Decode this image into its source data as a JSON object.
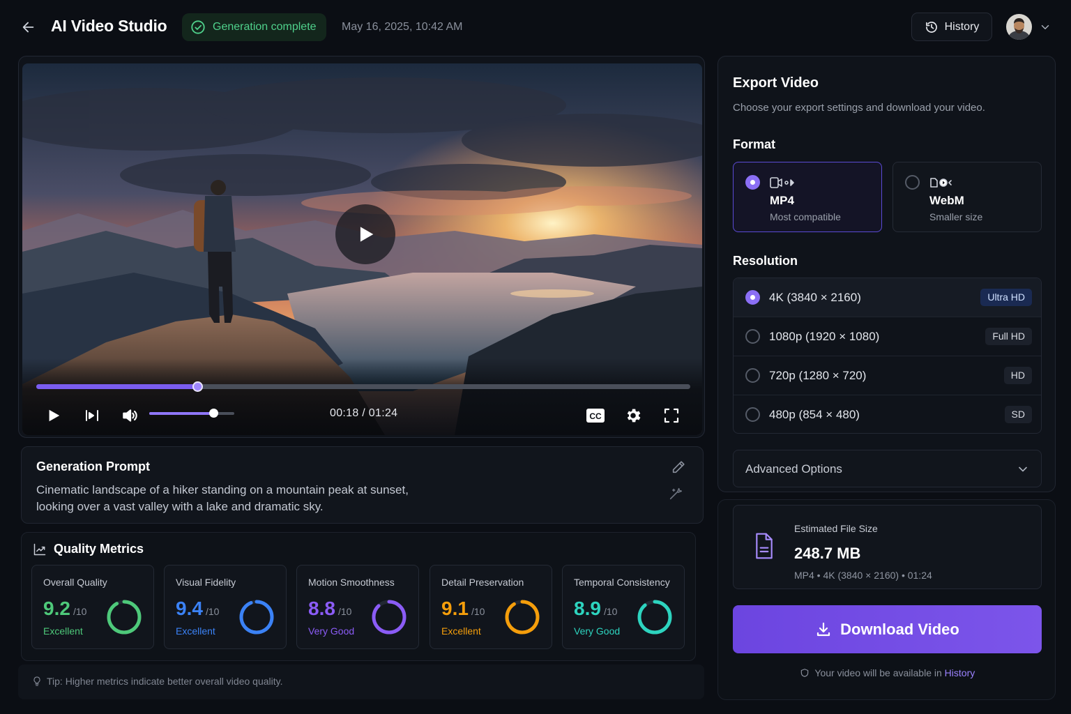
{
  "header": {
    "title": "AI Video Studio",
    "status": "Generation complete",
    "timestamp": "May 16, 2025, 10:42 AM",
    "history_label": "History"
  },
  "player": {
    "progress": 0.246,
    "volume": 0.75,
    "current_time": "00:18",
    "separator": "/",
    "duration": "01:24",
    "cc_label": "CC"
  },
  "prompt": {
    "title": "Generation Prompt",
    "text": "Cinematic landscape of a hiker standing on a mountain peak at sunset, looking over a vast valley with a lake and dramatic sky."
  },
  "metrics": {
    "title": "Quality Metrics",
    "items": [
      {
        "label": "Overall Quality",
        "value": "9.2",
        "max": "/10",
        "rating": "Excellent",
        "score": 9.2,
        "color": "#4ec97a"
      },
      {
        "label": "Visual Fidelity",
        "value": "9.4",
        "max": "/10",
        "rating": "Excellent",
        "score": 9.4,
        "color": "#3b82f6"
      },
      {
        "label": "Motion Smoothness",
        "value": "8.8",
        "max": "/10",
        "rating": "Very Good",
        "score": 8.8,
        "color": "#8b5cf6"
      },
      {
        "label": "Detail Preservation",
        "value": "9.1",
        "max": "/10",
        "rating": "Excellent",
        "score": 9.1,
        "color": "#f59e0b"
      },
      {
        "label": "Temporal Consistency",
        "value": "8.9",
        "max": "/10",
        "rating": "Very Good",
        "score": 8.9,
        "color": "#2dd4bf"
      }
    ]
  },
  "tip": "Tip: Higher metrics indicate better overall video quality.",
  "export": {
    "title": "Export Video",
    "subtitle": "Choose your export settings and download your video.",
    "format_label": "Format",
    "formats": [
      {
        "name": "MP4",
        "desc": "Most compatible",
        "selected": true
      },
      {
        "name": "WebM",
        "desc": "Smaller size",
        "selected": false
      }
    ],
    "resolution_label": "Resolution",
    "resolutions": [
      {
        "label": "4K (3840 × 2160)",
        "badge": "Ultra HD",
        "selected": true
      },
      {
        "label": "1080p (1920 × 1080)",
        "badge": "Full HD",
        "selected": false
      },
      {
        "label": "720p (1280 × 720)",
        "badge": "HD",
        "selected": false
      },
      {
        "label": "480p (854 × 480)",
        "badge": "SD",
        "selected": false
      }
    ],
    "advanced_label": "Advanced Options"
  },
  "download": {
    "size_label": "Estimated File Size",
    "size_value": "248.7 MB",
    "size_meta": "MP4 • 4K (3840 × 2160) • 01:24",
    "button_label": "Download Video",
    "note_prefix": "Your video will be available in",
    "note_link": "History"
  },
  "colors": {
    "accent": "#7c55ea",
    "success": "#4fd18b"
  }
}
